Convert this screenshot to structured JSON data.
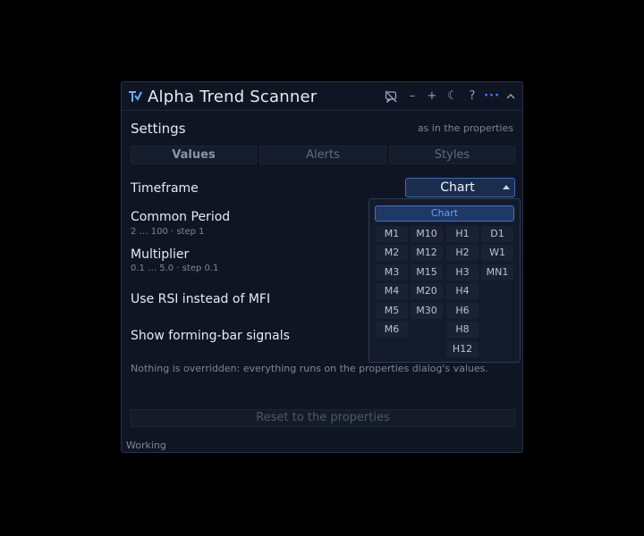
{
  "app": {
    "title": "Alpha Trend Scanner"
  },
  "titlebar_icons": [
    "chat-off-icon",
    "minimize-icon",
    "plus-icon",
    "moon-icon",
    "help-icon",
    "more-icon",
    "collapse-icon"
  ],
  "settings": {
    "title": "Settings",
    "subtitle": "as in the properties"
  },
  "tabs": [
    {
      "label": "Values",
      "active": true
    },
    {
      "label": "Alerts",
      "active": false
    },
    {
      "label": "Styles",
      "active": false
    }
  ],
  "rows": {
    "timeframe": {
      "label": "Timeframe",
      "value": "Chart"
    },
    "common_period": {
      "label": "Common Period",
      "hint": "2 … 100 · step 1"
    },
    "multiplier": {
      "label": "Multiplier",
      "hint": "0.1 … 5.0 · step 0.1"
    },
    "use_rsi": {
      "label": "Use RSI instead of MFI"
    },
    "forming_bar": {
      "label": "Show forming-bar signals"
    }
  },
  "note": "Nothing is overridden: everything runs on the properties dialog's values.",
  "reset_label": "Reset to the properties",
  "status": "Working",
  "dropdown": {
    "selected": "Chart",
    "minutes": [
      "M1",
      "M2",
      "M3",
      "M4",
      "M5",
      "M6"
    ],
    "minutes2": [
      "M10",
      "M12",
      "M15",
      "M20",
      "M30"
    ],
    "hours": [
      "H1",
      "H2",
      "H3",
      "H4",
      "H6",
      "H8",
      "H12"
    ],
    "other": [
      "D1",
      "W1",
      "MN1"
    ]
  },
  "colors": {
    "accent": "#3d8bff",
    "panel_bg": "#0f1522",
    "selected_bg": "#1f3866"
  }
}
